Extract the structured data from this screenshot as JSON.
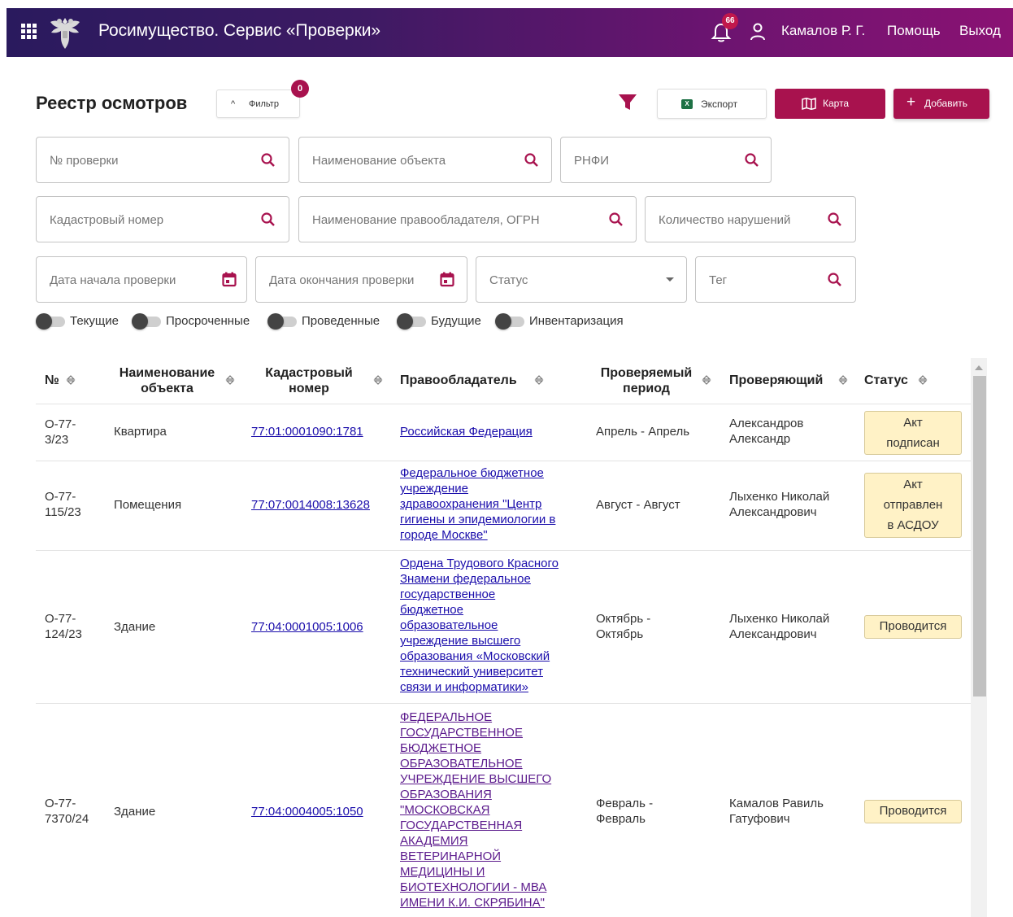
{
  "header": {
    "title": "Росимущество. Сервис «Проверки»",
    "notifications_count": "66",
    "user_name": "Камалов Р. Г.",
    "help": "Помощь",
    "logout": "Выход",
    "gradient_colors": [
      "#2a1a5e",
      "#8a1273"
    ]
  },
  "toolbar": {
    "page_title": "Реестр осмотров",
    "filter_label": "Фильтр",
    "filter_count": "0",
    "export_label": "Экспорт",
    "map_label": "Карта",
    "add_label": "Добавить",
    "accent_color": "#a8124e"
  },
  "filters": {
    "check_number": "№ проверки",
    "object_name": "Наименование объекта",
    "rnfi": "РНФИ",
    "cadastral": "Кадастровый номер",
    "owner": "Наименование правообладателя, ОГРН",
    "violations": "Количество нарушений",
    "date_start": "Дата начала проверки",
    "date_end": "Дата окончания проверки",
    "status": "Статус",
    "tag": "Тег"
  },
  "toggles": [
    "Текущие",
    "Просроченные",
    "Проведенные",
    "Будущие",
    "Инвентаризация"
  ],
  "table": {
    "headers": {
      "number": "№",
      "object_line1": "Наименование",
      "object_line2": "объекта",
      "cadastral_line1": "Кадастровый",
      "cadastral_line2": "номер",
      "owner": "Правообладатель",
      "period_line1": "Проверяемый",
      "period_line2": "период",
      "inspector": "Проверяющий",
      "status": "Статус"
    },
    "rows": [
      {
        "number": [
          "О-77-",
          "3/23"
        ],
        "object": "Квартира",
        "cadastral": "77:01:0001090:1781",
        "owner": [
          "Российская Федерация"
        ],
        "period": [
          "Апрель - Апрель"
        ],
        "inspector": [
          "Александров",
          "Александр"
        ],
        "status": [
          "Акт",
          "подписан"
        ]
      },
      {
        "number": [
          "О-77-",
          "115/23"
        ],
        "object": "Помещения",
        "cadastral": "77:07:0014008:13628",
        "owner": [
          "Федеральное бюджетное",
          "учреждение",
          "здравоохранения \"Центр",
          "гигиены и эпидемиологии в",
          "городе Москве\""
        ],
        "period": [
          "Август - Август"
        ],
        "inspector": [
          "Лыхенко Николай",
          "Александрович"
        ],
        "status": [
          "Акт",
          "отправлен",
          "в АСДОУ"
        ]
      },
      {
        "number": [
          "О-77-",
          "124/23"
        ],
        "object": "Здание",
        "cadastral": "77:04:0001005:1006",
        "owner": [
          "Ордена Трудового Красного",
          "Знамени федеральное",
          "государственное",
          "бюджетное",
          "образовательное",
          "учреждение высшего",
          "образования «Московский",
          "технический университет",
          "связи и информатики»"
        ],
        "period": [
          "Октябрь -",
          "Октябрь"
        ],
        "inspector": [
          "Лыхенко Николай",
          "Александрович"
        ],
        "status": [
          "Проводится"
        ]
      },
      {
        "number": [
          "О-77-",
          "7370/24"
        ],
        "object": "Здание",
        "cadastral": "77:04:0004005:1050",
        "owner": [
          "ФЕДЕРАЛЬНОЕ",
          "ГОСУДАРСТВЕННОЕ",
          "БЮДЖЕТНОЕ",
          "ОБРАЗОВАТЕЛЬНОЕ",
          "УЧРЕЖДЕНИЕ ВЫСШЕГО",
          "ОБРАЗОВАНИЯ",
          "\"МОСКОВСКАЯ",
          "ГОСУДАРСТВЕННАЯ",
          "АКАДЕМИЯ",
          "ВЕТЕРИНАРНОЙ",
          "МЕДИЦИНЫ И",
          "БИОТЕХНОЛОГИИ - МВА",
          "ИМЕНИ К.И. СКРЯБИНА\""
        ],
        "period": [
          "Февраль -",
          "Февраль"
        ],
        "inspector": [
          "Камалов Равиль",
          "Гатуфович"
        ],
        "status": [
          "Проводится"
        ]
      }
    ]
  }
}
